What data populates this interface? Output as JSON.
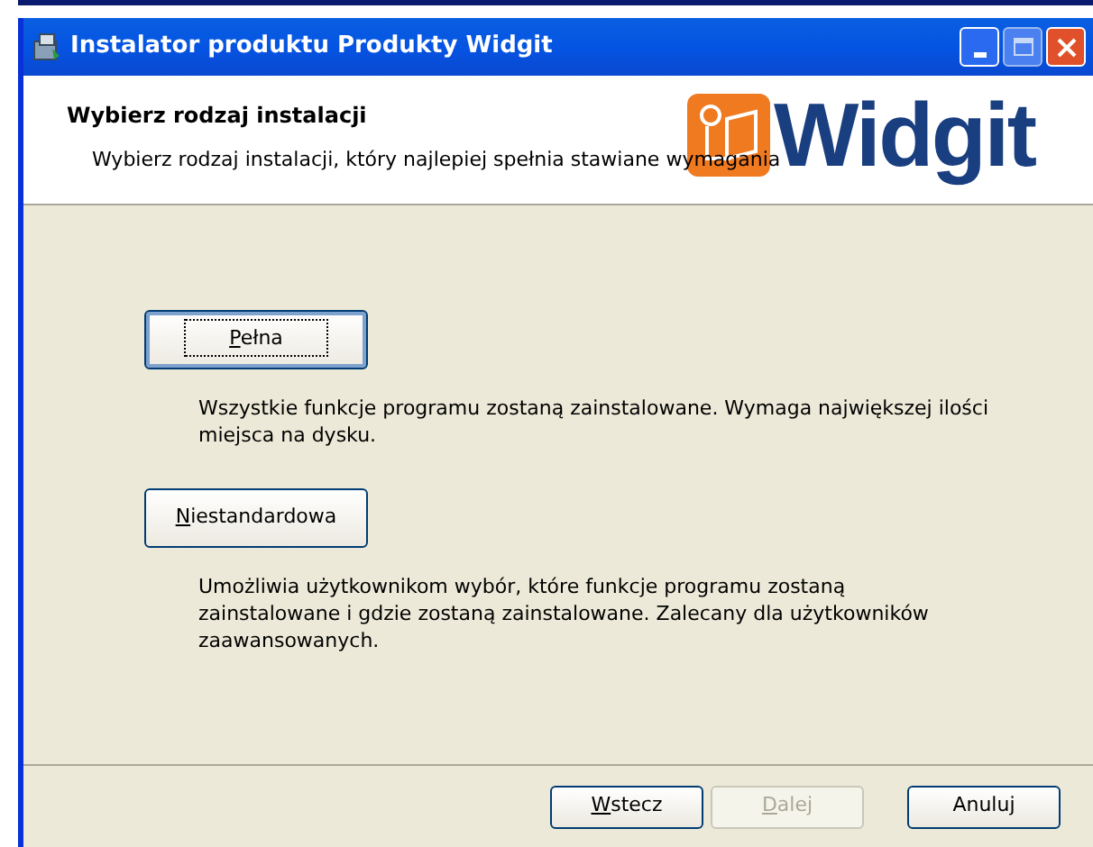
{
  "window": {
    "title": "Instalator produktu Produkty Widgit"
  },
  "header": {
    "title": "Wybierz rodzaj instalacji",
    "subtitle": "Wybierz rodzaj instalacji, który najlepiej spełnia stawiane wymagania",
    "logo_text": "Widgit"
  },
  "options": [
    {
      "label": "Pełna",
      "focused": true,
      "description": "Wszystkie funkcje programu zostaną zainstalowane. Wymaga największej ilości miejsca na dysku."
    },
    {
      "label": "Niestandardowa",
      "focused": false,
      "description": "Umożliwia użytkownikom wybór, które funkcje programu zostaną zainstalowane i gdzie zostaną zainstalowane. Zalecany dla użytkowników zaawansowanych."
    }
  ],
  "buttons": [
    {
      "label": "Wstecz",
      "disabled": false,
      "underline_first": true
    },
    {
      "label": "Dalej",
      "disabled": true,
      "underline_first": true
    },
    {
      "label": "Anuluj",
      "disabled": false,
      "underline_first": false
    }
  ]
}
